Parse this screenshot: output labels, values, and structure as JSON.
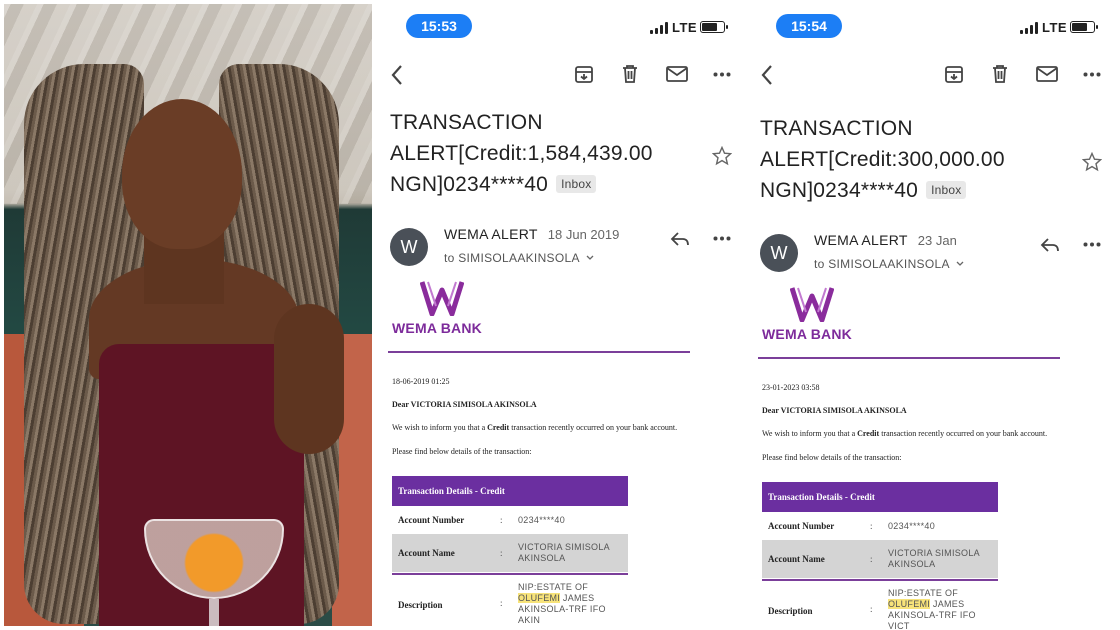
{
  "panels": [
    {
      "status_time": "15:53",
      "network": "LTE",
      "subject_line1": "TRANSACTION",
      "subject_line2": "ALERT[Credit:1,584,439.00",
      "subject_line3": "NGN]0234****40",
      "label": "Inbox",
      "avatar_letter": "W",
      "sender": "WEMA ALERT",
      "date": "18 Jun 2019",
      "recipient": "to SIMISOLAAKINSOLA",
      "bank_name": "WEMA BANK",
      "timestamp": "18-06-2019 01:25",
      "greeting": "Dear VICTORIA SIMISOLA AKINSOLA",
      "intro_pre": "We wish to inform you that a",
      "intro_bold": "Credit",
      "intro_post": "transaction recently occurred on your bank account.",
      "details_intro": "Please find below details of the transaction:",
      "table_title": "Transaction Details - Credit",
      "account_number_label": "Account Number",
      "account_number": "0234****40",
      "account_name_label": "Account Name",
      "account_name_line1": "VICTORIA SIMISOLA",
      "account_name_line2": "AKINSOLA",
      "description_label": "Description",
      "desc_line1": "NIP:ESTATE OF",
      "desc_hl": "OLUFEMI",
      "desc_line2_rest": " JAMES",
      "desc_line3": "AKINSOLA-TRF IFO",
      "desc_line4": "AKIN"
    },
    {
      "status_time": "15:54",
      "network": "LTE",
      "subject_line1": "TRANSACTION",
      "subject_line2": "ALERT[Credit:300,000.00",
      "subject_line3": "NGN]0234****40",
      "label": "Inbox",
      "avatar_letter": "W",
      "sender": "WEMA ALERT",
      "date": "23 Jan",
      "recipient": "to SIMISOLAAKINSOLA",
      "bank_name": "WEMA BANK",
      "timestamp": "23-01-2023 03:58",
      "greeting": "Dear VICTORIA SIMISOLA AKINSOLA",
      "intro_pre": "We wish to inform you that a",
      "intro_bold": "Credit",
      "intro_post": "transaction recently occurred on your bank account.",
      "details_intro": "Please find below details of the transaction:",
      "table_title": "Transaction Details - Credit",
      "account_number_label": "Account Number",
      "account_number": "0234****40",
      "account_name_label": "Account Name",
      "account_name_line1": "VICTORIA SIMISOLA",
      "account_name_line2": "AKINSOLA",
      "description_label": "Description",
      "desc_line1": "NIP:ESTATE OF",
      "desc_hl": "OLUFEMI",
      "desc_line2_rest": " JAMES",
      "desc_line3": "AKINSOLA-TRF IFO",
      "desc_line4": "VICT"
    }
  ],
  "icons": [
    "back-icon",
    "archive-icon",
    "trash-icon",
    "mail-icon",
    "more-icon",
    "star-icon",
    "reply-icon",
    "chevron-down-icon",
    "wema-logo-icon"
  ],
  "colors": {
    "brand_purple": "#6b2fa0",
    "status_pill": "#1c7ef5",
    "highlight": "#f7e37a"
  },
  "battery_level": 0.65
}
